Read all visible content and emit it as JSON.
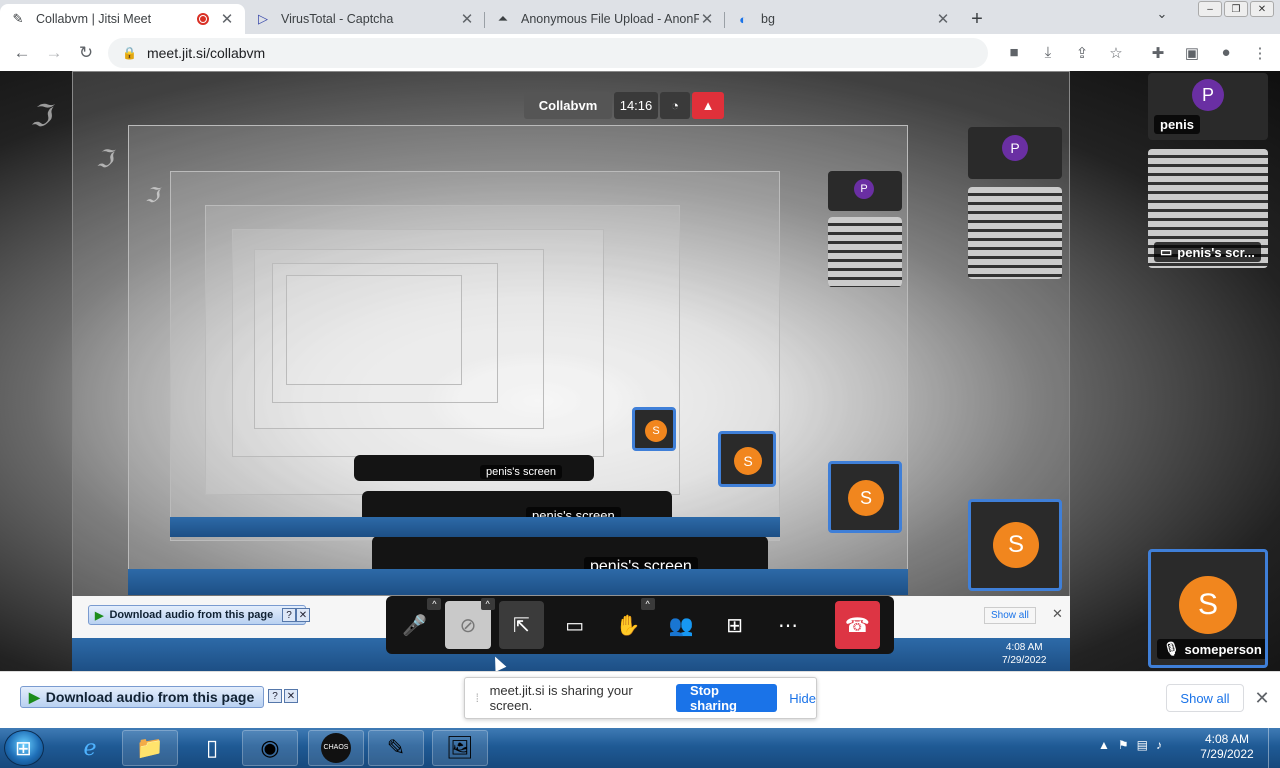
{
  "browser": {
    "tabs": [
      {
        "title": "Collabvm | Jitsi Meet",
        "icon": "feather-icon",
        "active": true,
        "recording": true
      },
      {
        "title": "VirusTotal - Captcha",
        "icon": "virustotal-icon",
        "active": false
      },
      {
        "title": "Anonymous File Upload - AnonFi",
        "icon": "upload-icon",
        "active": false
      },
      {
        "title": "bg",
        "icon": "edge-icon",
        "active": false
      }
    ],
    "address": "meet.jit.si/collabvm"
  },
  "meeting": {
    "room_name": "Collabvm",
    "timer": "14:16",
    "participants": [
      {
        "name": "penis",
        "initial": "P"
      },
      {
        "name": "penis's scr...",
        "type": "screen"
      },
      {
        "name": "someperson",
        "initial": "S"
      }
    ],
    "screen_caption": "penis's screen"
  },
  "nested": {
    "download_label": "Download audio from this page",
    "show_all": "Show all",
    "time": "4:08 AM",
    "date": "7/29/2022"
  },
  "shelf": {
    "download_label": "Download audio from this page",
    "share_message": "meet.jit.si is sharing your screen.",
    "stop_sharing": "Stop sharing",
    "hide": "Hide",
    "show_all": "Show all"
  },
  "taskbar": {
    "time": "4:08 AM",
    "date": "7/29/2022",
    "items": [
      "ie-icon",
      "explorer-icon",
      "file-icon",
      "chrome-icon",
      "chaos-icon",
      "notepad-icon",
      "picture-icon"
    ]
  },
  "colors": {
    "accent": "#1a73e8",
    "hangup": "#dd3544",
    "avatar_p": "#6a2fa3",
    "avatar_s": "#f1861e",
    "active_border": "#3f7fd8"
  }
}
